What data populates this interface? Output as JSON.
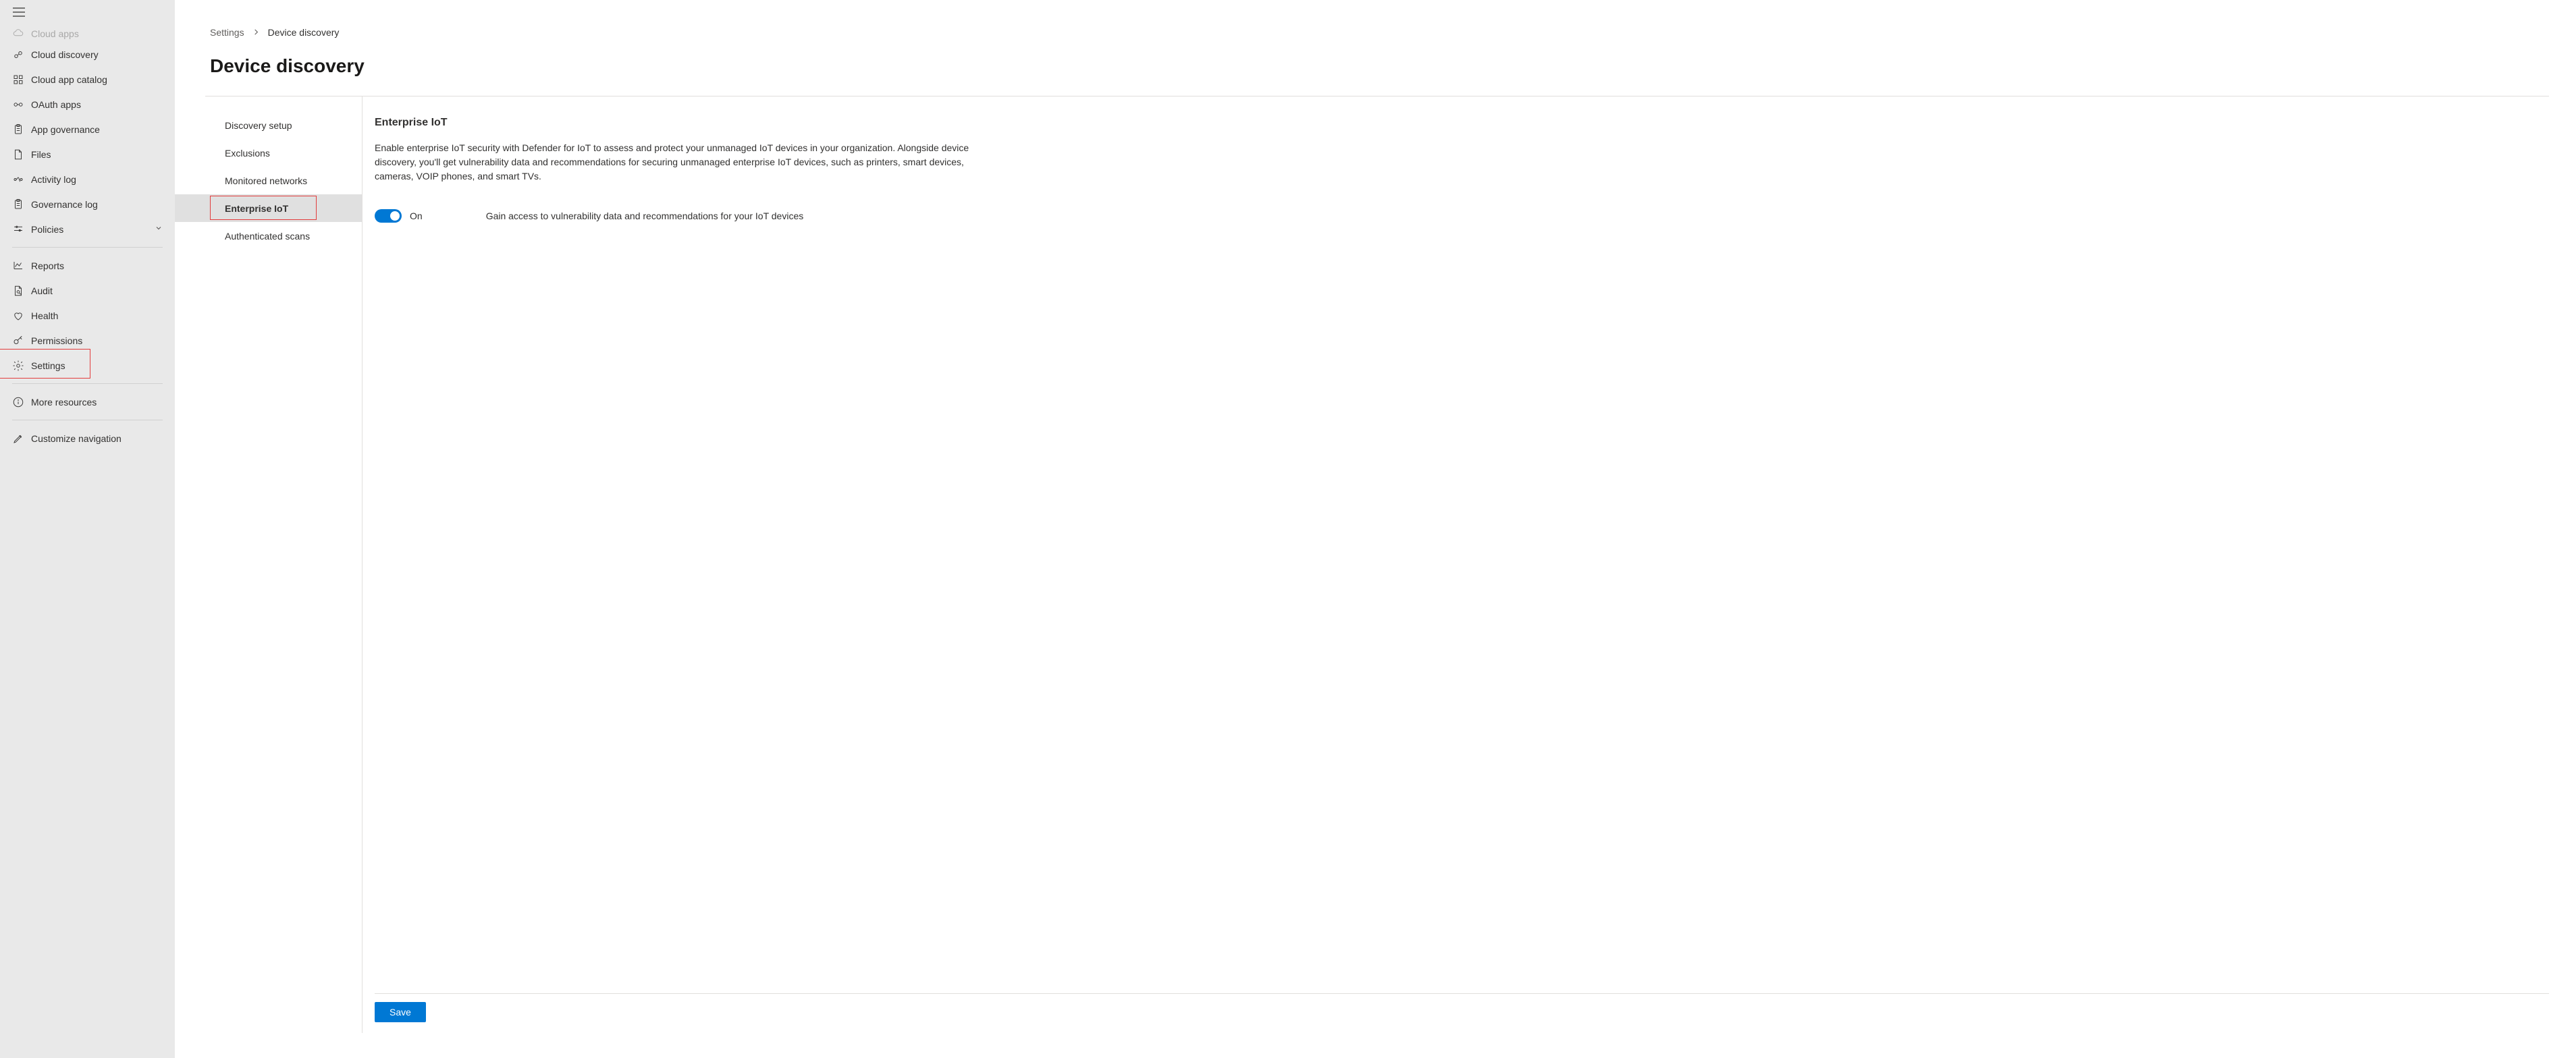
{
  "breadcrumb": {
    "settings": "Settings",
    "current": "Device discovery"
  },
  "page_title": "Device discovery",
  "sidebar": {
    "cut_top": "Cloud apps",
    "items": [
      {
        "id": "cloud-discovery",
        "label": "Cloud discovery",
        "icon": "cloud-discovery"
      },
      {
        "id": "cloud-app-catalog",
        "label": "Cloud app catalog",
        "icon": "catalog"
      },
      {
        "id": "oauth-apps",
        "label": "OAuth apps",
        "icon": "oauth"
      },
      {
        "id": "app-governance",
        "label": "App governance",
        "icon": "clipboard"
      },
      {
        "id": "files",
        "label": "Files",
        "icon": "files"
      },
      {
        "id": "activity-log",
        "label": "Activity log",
        "icon": "activity"
      },
      {
        "id": "governance-log",
        "label": "Governance log",
        "icon": "clipboard"
      },
      {
        "id": "policies",
        "label": "Policies",
        "icon": "sliders",
        "chevron": true
      }
    ],
    "section2": [
      {
        "id": "reports",
        "label": "Reports",
        "icon": "chart"
      },
      {
        "id": "audit",
        "label": "Audit",
        "icon": "audit"
      },
      {
        "id": "health",
        "label": "Health",
        "icon": "heart"
      },
      {
        "id": "permissions",
        "label": "Permissions",
        "icon": "key"
      },
      {
        "id": "settings",
        "label": "Settings",
        "icon": "gear",
        "highlight": true
      }
    ],
    "section3": [
      {
        "id": "more-resources",
        "label": "More resources",
        "icon": "info"
      }
    ],
    "section4": [
      {
        "id": "customize-navigation",
        "label": "Customize navigation",
        "icon": "pencil"
      }
    ]
  },
  "subnav": {
    "items": [
      {
        "id": "discovery-setup",
        "label": "Discovery setup"
      },
      {
        "id": "exclusions",
        "label": "Exclusions"
      },
      {
        "id": "monitored-networks",
        "label": "Monitored networks"
      },
      {
        "id": "enterprise-iot",
        "label": "Enterprise IoT",
        "active": true,
        "highlight": true
      },
      {
        "id": "authenticated-scans",
        "label": "Authenticated scans"
      }
    ]
  },
  "detail": {
    "title": "Enterprise IoT",
    "description": "Enable enterprise IoT security with Defender for IoT to assess and protect your unmanaged IoT devices in your organization. Alongside device discovery, you'll get vulnerability data and recommendations for securing unmanaged enterprise IoT devices, such as printers, smart devices, cameras, VOIP phones, and smart TVs.",
    "toggle_state": "On",
    "toggle_description": "Gain access to vulnerability data and recommendations for your IoT devices",
    "save_label": "Save"
  }
}
